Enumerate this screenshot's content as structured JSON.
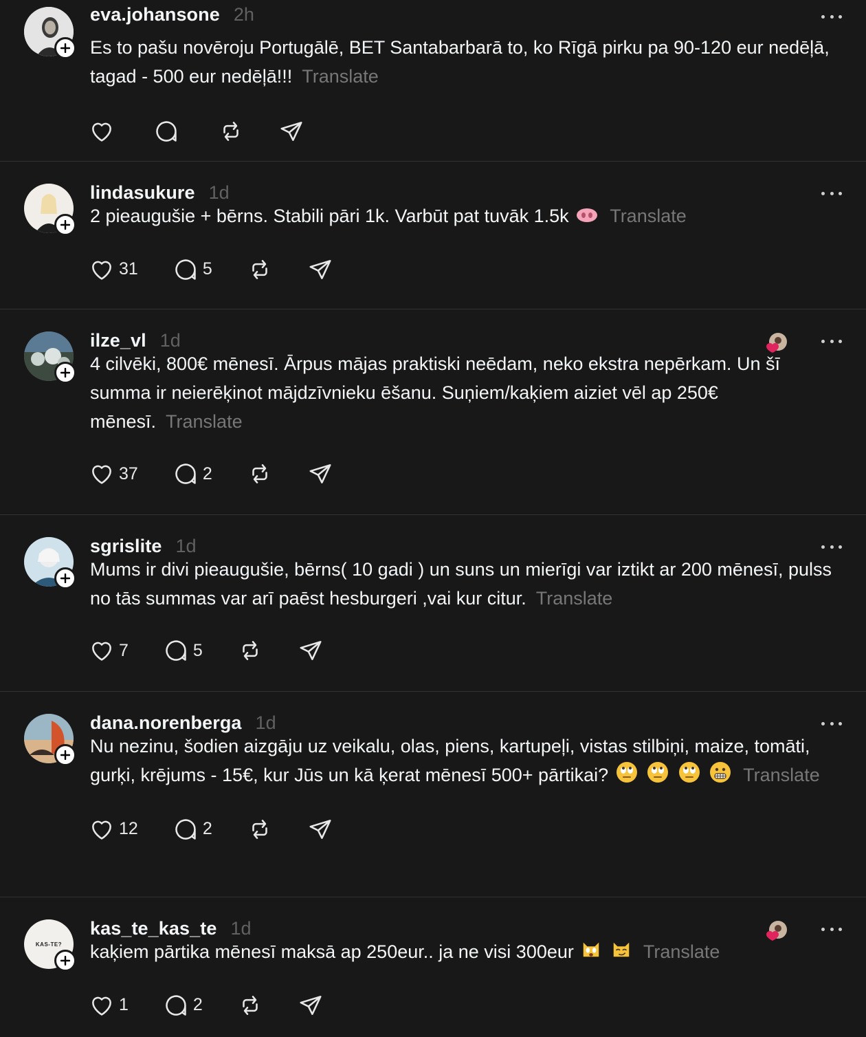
{
  "ui": {
    "translate_label": "Translate"
  },
  "posts": [
    {
      "username": "eva.johansone",
      "time": "2h",
      "text": "Es to pašu novēroju Portugālē, BET Santabarbarā to, ko Rīgā pirku pa 90-120 eur nedēļā, tagad - 500 eur nedēļā!!!",
      "likes": "",
      "replies": "",
      "avatar_color": "#dcdcdc",
      "emojis": [],
      "liked_by_badge": false
    },
    {
      "username": "lindasukure",
      "time": "1d",
      "text": "2 pieaugušie + bērns. Stabili pāri 1k. Varbūt pat tuvāk 1.5k",
      "likes": "31",
      "replies": "5",
      "avatar_color": "#e8e4df",
      "emojis": [
        "pig-nose-emoji"
      ],
      "liked_by_badge": false
    },
    {
      "username": "ilze_vl",
      "time": "1d",
      "text": "4 cilvēki, 800€ mēnesī. Ārpus mājas praktiski neēdam, neko ekstra nepērkam. Un šī summa ir neierēķinot mājdzīvnieku ēšanu. Suņiem/kaķiem aiziet vēl ap 250€ mēnesī.",
      "likes": "37",
      "replies": "2",
      "avatar_color": "#6e7f8c",
      "emojis": [],
      "liked_by_badge": true
    },
    {
      "username": "sgrislite",
      "time": "1d",
      "text": "Mums ir divi pieaugušie, bērns( 10 gadi ) un suns un mierīgi var iztikt ar 200 mēnesī, pulss no tās summas var arī paēst hesburgeri ,vai kur citur.",
      "likes": "7",
      "replies": "5",
      "avatar_color": "#a9c7d6",
      "emojis": [],
      "liked_by_badge": false
    },
    {
      "username": "dana.norenberga",
      "time": "1d",
      "text": "Nu nezinu, šodien aizgāju uz veikalu, olas, piens, kartupeļi, vistas stilbiņi, maize, tomāti, gurķi, krējums - 15€, kur Jūs un kā ķerat mēnesī 500+ pārtikai?",
      "likes": "12",
      "replies": "2",
      "avatar_color": "#b86a3c",
      "emojis": [
        "eye-roll-emoji",
        "eye-roll-emoji",
        "eye-roll-emoji",
        "grimacing-emoji"
      ],
      "liked_by_badge": false
    },
    {
      "username": "kas_te_kas_te",
      "time": "1d",
      "text": "kaķiem pārtika mēnesī maksā ap 250eur.. ja ne visi 300eur",
      "likes": "1",
      "replies": "2",
      "avatar_color": "#f2f0ec",
      "avatar_text": "KAS-TE?",
      "emojis": [
        "weary-cat-emoji",
        "smirk-cat-emoji"
      ],
      "liked_by_badge": true
    }
  ]
}
